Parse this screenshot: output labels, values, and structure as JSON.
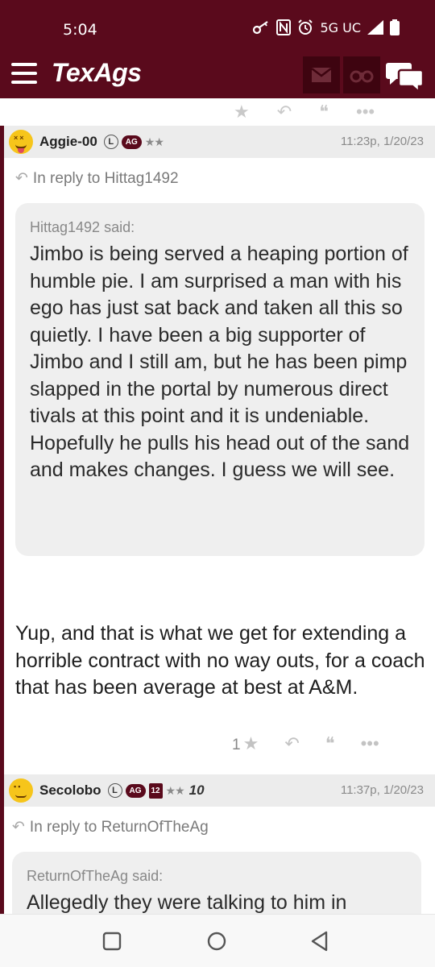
{
  "status": {
    "time": "5:04",
    "network": "5G UC"
  },
  "header": {
    "logo": "TexAgs"
  },
  "posts": [
    {
      "username": "Aggie-00",
      "badge_l": "L",
      "badge_ag": "AG",
      "stars": "★★",
      "time": "11:23p, 1/20/23",
      "reply_to": "In reply to Hittag1492",
      "quote_author": "Hittag1492 said:",
      "quote_text": "Jimbo is being served a heaping portion of humble pie. I am surprised a man with his ego has just sat back and taken all this so quietly. I have been a big supporter of Jimbo and I still am, but he has been pimp slapped in the portal by numerous direct tivals at this point and it is undeniable. Hopefully he pulls his head out of the sand and makes changes. I guess we will see.",
      "body": "Yup, and that is what we get for extending a horrible contract with no way outs, for a coach that has been average at best at A&M.",
      "likes": "1"
    },
    {
      "username": "Secolobo",
      "badge_l": "L",
      "badge_ag": "AG",
      "badge_12": "12",
      "stars": "★★",
      "badge_10": "10",
      "time": "11:37p, 1/20/23",
      "reply_to": "In reply to ReturnOfTheAg",
      "quote_author": "ReturnOfTheAg said:",
      "quote_text": "Allegedly they were talking to him in"
    }
  ],
  "colors": {
    "brand": "#5a0a1c",
    "header_button": "#3e0410",
    "quote_bg": "#efefef"
  },
  "icons": [
    "key-icon",
    "nfc-icon",
    "alarm-icon",
    "signal-icon",
    "battery-icon",
    "menu-icon",
    "mail-icon",
    "binoculars-icon",
    "chat-icon",
    "star-icon",
    "reply-icon",
    "quote-icon",
    "more-icon",
    "back-nav-icon",
    "home-nav-icon",
    "recent-apps-icon"
  ]
}
